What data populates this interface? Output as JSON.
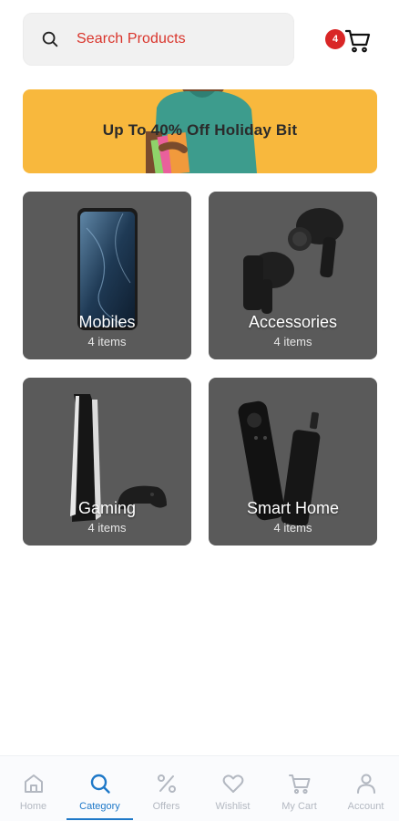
{
  "search": {
    "placeholder_text": "Search Products",
    "icon": "search-icon"
  },
  "cart": {
    "badge_count": "4",
    "icon": "cart-icon"
  },
  "banner": {
    "text": "Up To 40% Off Holiday Bit",
    "accent_color": "#f8b83d"
  },
  "categories": [
    {
      "name": "Mobiles",
      "count": "4 items"
    },
    {
      "name": "Accessories",
      "count": "4 items"
    },
    {
      "name": "Gaming",
      "count": "4 items"
    },
    {
      "name": "Smart Home",
      "count": "4 items"
    }
  ],
  "nav": {
    "active": "Category",
    "active_color": "#1e78c8",
    "items": [
      {
        "label": "Home",
        "icon": "home-icon"
      },
      {
        "label": "Category",
        "icon": "search-icon"
      },
      {
        "label": "Offers",
        "icon": "percent-icon"
      },
      {
        "label": "Wishlist",
        "icon": "heart-icon"
      },
      {
        "label": "My Cart",
        "icon": "cart-icon"
      },
      {
        "label": "Account",
        "icon": "person-icon"
      }
    ]
  }
}
